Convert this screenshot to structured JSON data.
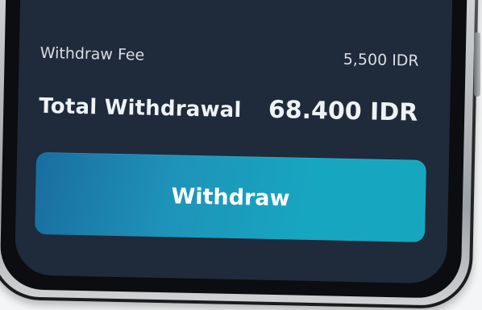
{
  "summary": {
    "fee_label": "Withdraw Fee",
    "fee_value": "5,500 IDR",
    "total_label": "Total Withdrawal",
    "total_value": "68.400 IDR"
  },
  "actions": {
    "withdraw_label": "Withdraw"
  },
  "colors": {
    "screen_background": "#1f2a3a",
    "button_gradient_start": "#1a6da0",
    "button_gradient_end": "#16a7bf",
    "text_primary": "#eef2f6"
  }
}
